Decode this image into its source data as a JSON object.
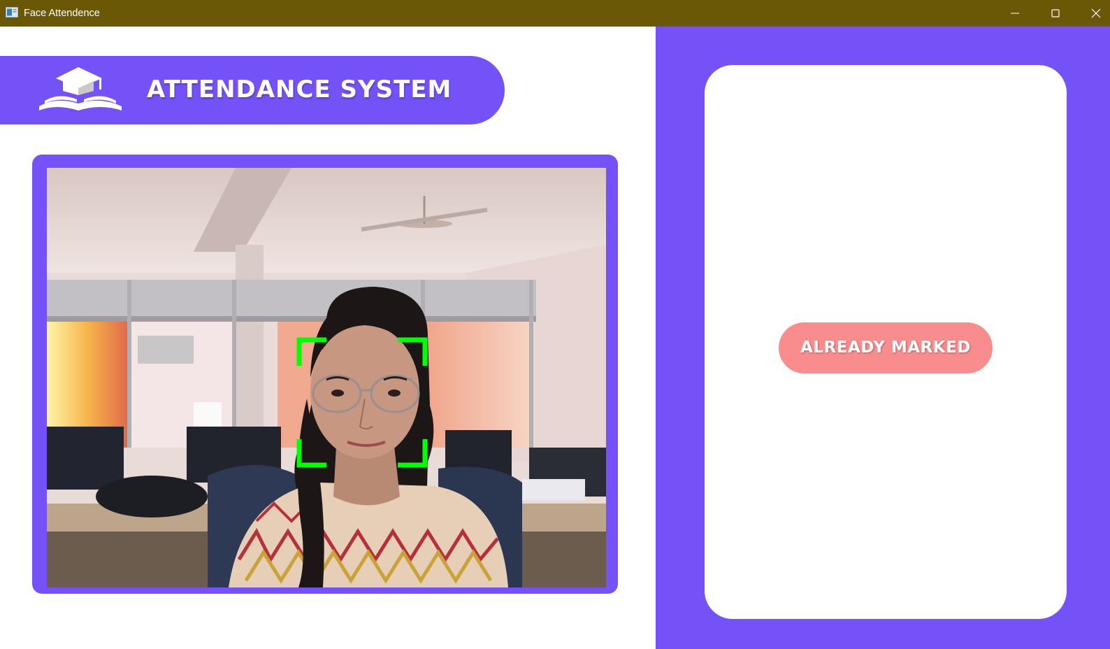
{
  "window": {
    "title": "Face Attendence",
    "titlebar_color": "#6b5806",
    "icons": [
      "app-icon",
      "minimize-icon",
      "maximize-icon",
      "close-icon"
    ]
  },
  "header": {
    "title": "ATTENDANCE SYSTEM",
    "logo_icon": "graduation-cap-book-icon",
    "color": "#7452f8"
  },
  "camera": {
    "face_box_color": "#00ff00"
  },
  "status": {
    "label": "ALREADY MARKED",
    "color": "#f98c8c"
  },
  "theme": {
    "accent": "#7452f8",
    "background": "#ffffff"
  }
}
